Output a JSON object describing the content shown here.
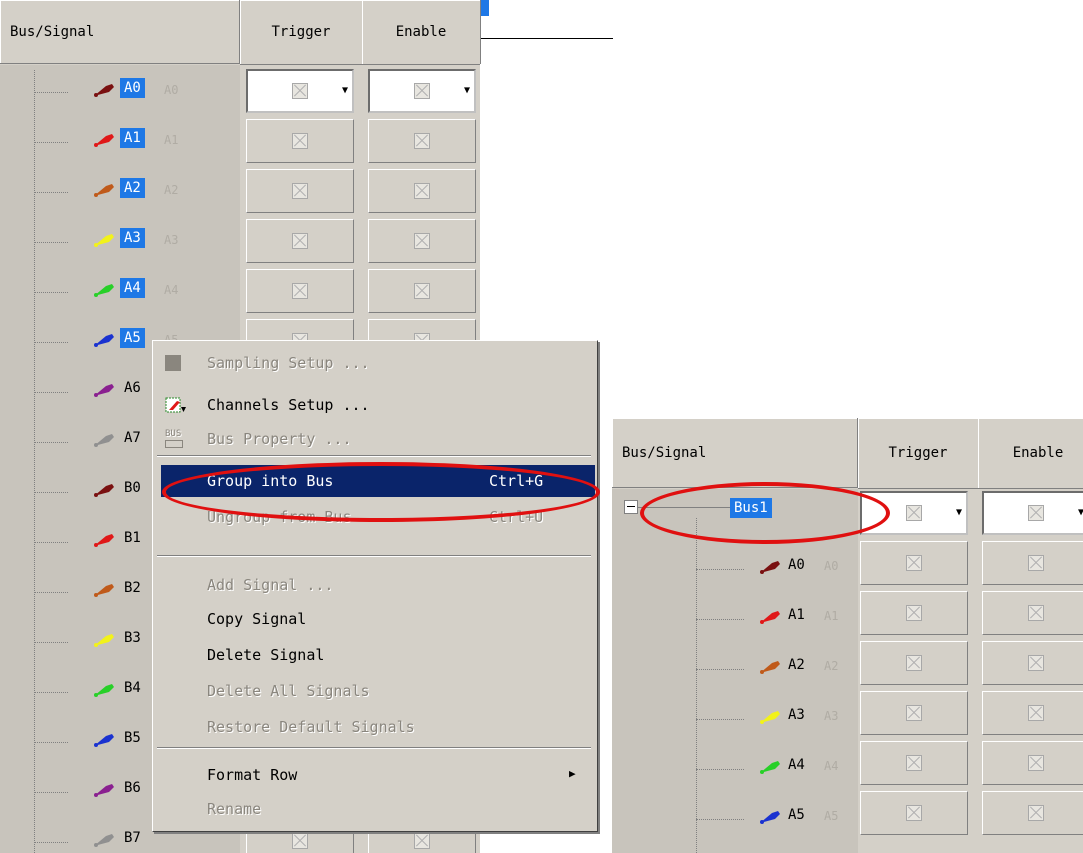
{
  "columns": {
    "bus_signal": "Bus/Signal",
    "trigger": "Trigger",
    "enable": "Enable"
  },
  "left_signals": [
    "A0",
    "A1",
    "A2",
    "A3",
    "A4",
    "A5",
    "A6",
    "A7",
    "B0",
    "B1",
    "B2",
    "B3",
    "B4",
    "B5",
    "B6",
    "B7"
  ],
  "left_ghost": [
    "A0",
    "A1",
    "A2",
    "A3",
    "A4",
    "A5"
  ],
  "probe_colors": [
    "#7a1010",
    "#e01818",
    "#c05a1a",
    "#f2f21a",
    "#28d028",
    "#1a32d0",
    "#8a2090",
    "#909090",
    "#7a1010",
    "#e01818",
    "#c05a1a",
    "#f2f21a",
    "#28d028",
    "#1a32d0",
    "#8a2090",
    "#909090"
  ],
  "menu": {
    "items": [
      {
        "label": "Sampling Setup ...",
        "shortcut": "",
        "disabled": true,
        "icon": "sampling-icon"
      },
      {
        "label": "Channels Setup ...",
        "shortcut": "",
        "disabled": false,
        "icon": "channels-icon"
      },
      {
        "label": "Bus Property ...",
        "shortcut": "",
        "disabled": true,
        "icon": "bus-icon"
      },
      {
        "label": "Group into Bus",
        "shortcut": "Ctrl+G",
        "disabled": false,
        "highlighted": true
      },
      {
        "label": "Ungroup from Bus",
        "shortcut": "Ctrl+U",
        "disabled": true
      },
      {
        "label": "Add Signal ...",
        "shortcut": "",
        "disabled": true
      },
      {
        "label": "Copy Signal",
        "shortcut": "",
        "disabled": false
      },
      {
        "label": "Delete Signal",
        "shortcut": "",
        "disabled": false
      },
      {
        "label": "Delete All Signals",
        "shortcut": "",
        "disabled": true
      },
      {
        "label": "Restore Default Signals",
        "shortcut": "",
        "disabled": true
      },
      {
        "label": "Format Row",
        "shortcut": "",
        "disabled": false,
        "submenu": true
      },
      {
        "label": "Rename",
        "shortcut": "",
        "disabled": true
      }
    ],
    "bus_icon_text": "BUS"
  },
  "right": {
    "bus_name": "Bus1",
    "signals": [
      "A0",
      "A1",
      "A2",
      "A3",
      "A4",
      "A5"
    ],
    "ghost": [
      "A0",
      "A1",
      "A2",
      "A3",
      "A4",
      "A5"
    ]
  }
}
